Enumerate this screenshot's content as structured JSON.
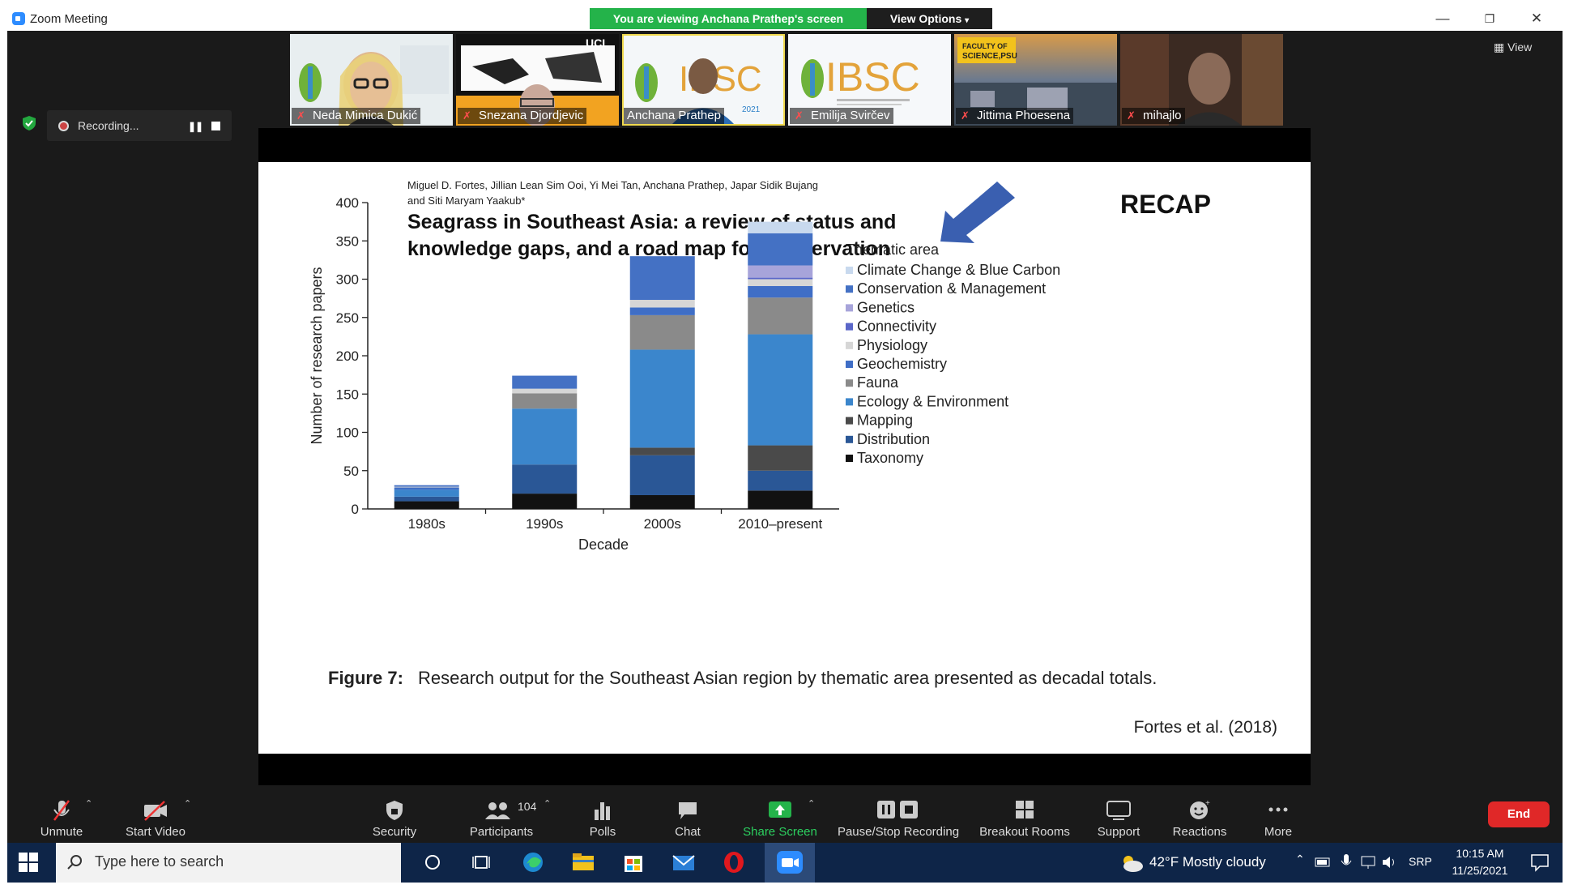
{
  "window": {
    "title": "Zoom Meeting"
  },
  "banner": {
    "viewing": "You are viewing Anchana Prathep's screen",
    "view_options": "View Options"
  },
  "gallery": {
    "view_label": "View",
    "participants": [
      {
        "name": "Neda Mimica Dukić",
        "muted": true,
        "active": false
      },
      {
        "name": "Snezana Djordjevic",
        "muted": true,
        "active": false
      },
      {
        "name": "Anchana Prathep",
        "muted": false,
        "active": true
      },
      {
        "name": "Emilija Svirčev",
        "muted": true,
        "active": false
      },
      {
        "name": "Jittima Phoesena",
        "muted": true,
        "active": false
      },
      {
        "name": "mihajlo",
        "muted": true,
        "active": false
      }
    ]
  },
  "recording": {
    "label": "Recording..."
  },
  "slide": {
    "recap": "RECAP",
    "authors_line1": "Miguel D. Fortes, Jillian Lean Sim Ooi, Yi Mei Tan, Anchana Prathep, Japar Sidik Bujang",
    "authors_line2": "and Siti Maryam Yaakub*",
    "paper_title_line1": "Seagrass in Southeast Asia: a review of status and",
    "paper_title_line2": "knowledge gaps, and a road map for conservation",
    "figure_label": "Figure 7:",
    "caption": "Research output for the Southeast Asian region by thematic area presented as decadal totals.",
    "citation": "Fortes et al. (2018)"
  },
  "chart_data": {
    "type": "bar",
    "stacked": true,
    "xlabel": "Decade",
    "ylabel": "Number of research papers",
    "ylim": [
      0,
      400
    ],
    "yticks": [
      0,
      50,
      100,
      150,
      200,
      250,
      300,
      350,
      400
    ],
    "categories": [
      "1980s",
      "1990s",
      "2000s",
      "2010–present"
    ],
    "legend_title": "Thematic area",
    "series": [
      {
        "name": "Taxonomy",
        "color": "#111111",
        "values": [
          10,
          20,
          18,
          24
        ]
      },
      {
        "name": "Distribution",
        "color": "#2a5796",
        "values": [
          6,
          38,
          52,
          26
        ]
      },
      {
        "name": "Mapping",
        "color": "#4a4a4a",
        "values": [
          0,
          0,
          10,
          33
        ]
      },
      {
        "name": "Ecology & Environment",
        "color": "#3b86cc",
        "values": [
          9,
          73,
          128,
          145
        ]
      },
      {
        "name": "Fauna",
        "color": "#8a8a8a",
        "values": [
          0,
          20,
          45,
          48
        ]
      },
      {
        "name": "Geochemistry",
        "color": "#3f6ec6",
        "values": [
          3,
          0,
          10,
          15
        ]
      },
      {
        "name": "Physiology",
        "color": "#d6d6d6",
        "values": [
          1,
          6,
          10,
          9
        ]
      },
      {
        "name": "Connectivity",
        "color": "#5a66c8",
        "values": [
          0,
          0,
          0,
          2
        ]
      },
      {
        "name": "Genetics",
        "color": "#a7a4da",
        "values": [
          0,
          0,
          0,
          16
        ]
      },
      {
        "name": "Conservation & Management",
        "color": "#4471c4",
        "values": [
          2,
          17,
          57,
          42
        ]
      },
      {
        "name": "Climate Change & Blue Carbon",
        "color": "#c8d9ee",
        "values": [
          0,
          0,
          0,
          15
        ]
      }
    ],
    "legend": "right"
  },
  "toolbar": {
    "unmute": "Unmute",
    "start_video": "Start Video",
    "security": "Security",
    "participants": "Participants",
    "participants_count": "104",
    "polls": "Polls",
    "chat": "Chat",
    "share_screen": "Share Screen",
    "pause_stop_recording": "Pause/Stop Recording",
    "breakout_rooms": "Breakout Rooms",
    "support": "Support",
    "reactions": "Reactions",
    "more": "More",
    "end": "End"
  },
  "taskbar": {
    "search_placeholder": "Type here to search",
    "weather": "42°F  Mostly cloudy",
    "language": "SRP",
    "time": "10:15 AM",
    "date": "11/25/2021"
  }
}
